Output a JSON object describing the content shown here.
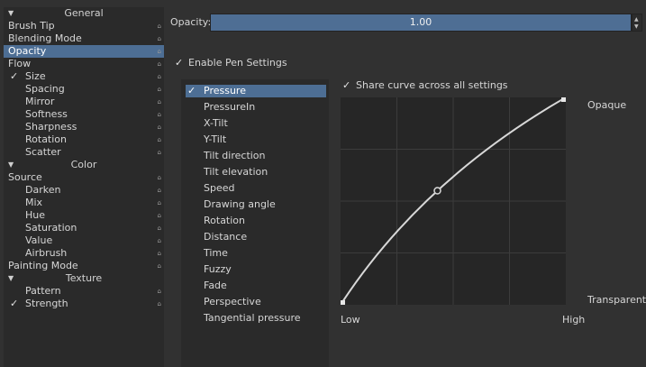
{
  "left_panel": {
    "rows": [
      {
        "label": "General",
        "type": "header"
      },
      {
        "label": "Brush Tip",
        "type": "item",
        "indent": 0
      },
      {
        "label": "Blending Mode",
        "type": "item",
        "indent": 0
      },
      {
        "label": "Opacity",
        "type": "item",
        "indent": 0,
        "selected": true
      },
      {
        "label": "Flow",
        "type": "item",
        "indent": 0
      },
      {
        "label": "Size",
        "type": "item",
        "indent": 1,
        "checked": true
      },
      {
        "label": "Spacing",
        "type": "item",
        "indent": 1
      },
      {
        "label": "Mirror",
        "type": "item",
        "indent": 1
      },
      {
        "label": "Softness",
        "type": "item",
        "indent": 1
      },
      {
        "label": "Sharpness",
        "type": "item",
        "indent": 1
      },
      {
        "label": "Rotation",
        "type": "item",
        "indent": 1
      },
      {
        "label": "Scatter",
        "type": "item",
        "indent": 1
      },
      {
        "label": "Color",
        "type": "header"
      },
      {
        "label": "Source",
        "type": "item",
        "indent": 0
      },
      {
        "label": "Darken",
        "type": "item",
        "indent": 1
      },
      {
        "label": "Mix",
        "type": "item",
        "indent": 1
      },
      {
        "label": "Hue",
        "type": "item",
        "indent": 1
      },
      {
        "label": "Saturation",
        "type": "item",
        "indent": 1
      },
      {
        "label": "Value",
        "type": "item",
        "indent": 1
      },
      {
        "label": "Airbrush",
        "type": "item",
        "indent": 1
      },
      {
        "label": "Painting Mode",
        "type": "item",
        "indent": 0
      },
      {
        "label": "Texture",
        "type": "header"
      },
      {
        "label": "Pattern",
        "type": "item",
        "indent": 1
      },
      {
        "label": "Strength",
        "type": "item",
        "indent": 1,
        "checked": true
      }
    ]
  },
  "opacity": {
    "label": "Opacity:",
    "value": "1.00",
    "fraction": 1.0
  },
  "enable_pen": {
    "label": "Enable Pen Settings",
    "checked": true
  },
  "share_curve": {
    "label": "Share curve across all settings",
    "checked": true
  },
  "sensors": [
    {
      "label": "Pressure",
      "selected": true,
      "checked": true
    },
    {
      "label": "PressureIn"
    },
    {
      "label": "X-Tilt"
    },
    {
      "label": "Y-Tilt"
    },
    {
      "label": "Tilt direction"
    },
    {
      "label": "Tilt elevation"
    },
    {
      "label": "Speed"
    },
    {
      "label": "Drawing angle"
    },
    {
      "label": "Rotation"
    },
    {
      "label": "Distance"
    },
    {
      "label": "Time"
    },
    {
      "label": "Fuzzy"
    },
    {
      "label": "Fade"
    },
    {
      "label": "Perspective"
    },
    {
      "label": "Tangential pressure"
    }
  ],
  "curve": {
    "label_top": "Opaque",
    "label_bottom": "Transparent",
    "label_low": "Low",
    "label_high": "High",
    "points": [
      [
        0.0,
        0.0
      ],
      [
        0.43,
        0.55
      ],
      [
        1.0,
        1.0
      ]
    ]
  }
}
